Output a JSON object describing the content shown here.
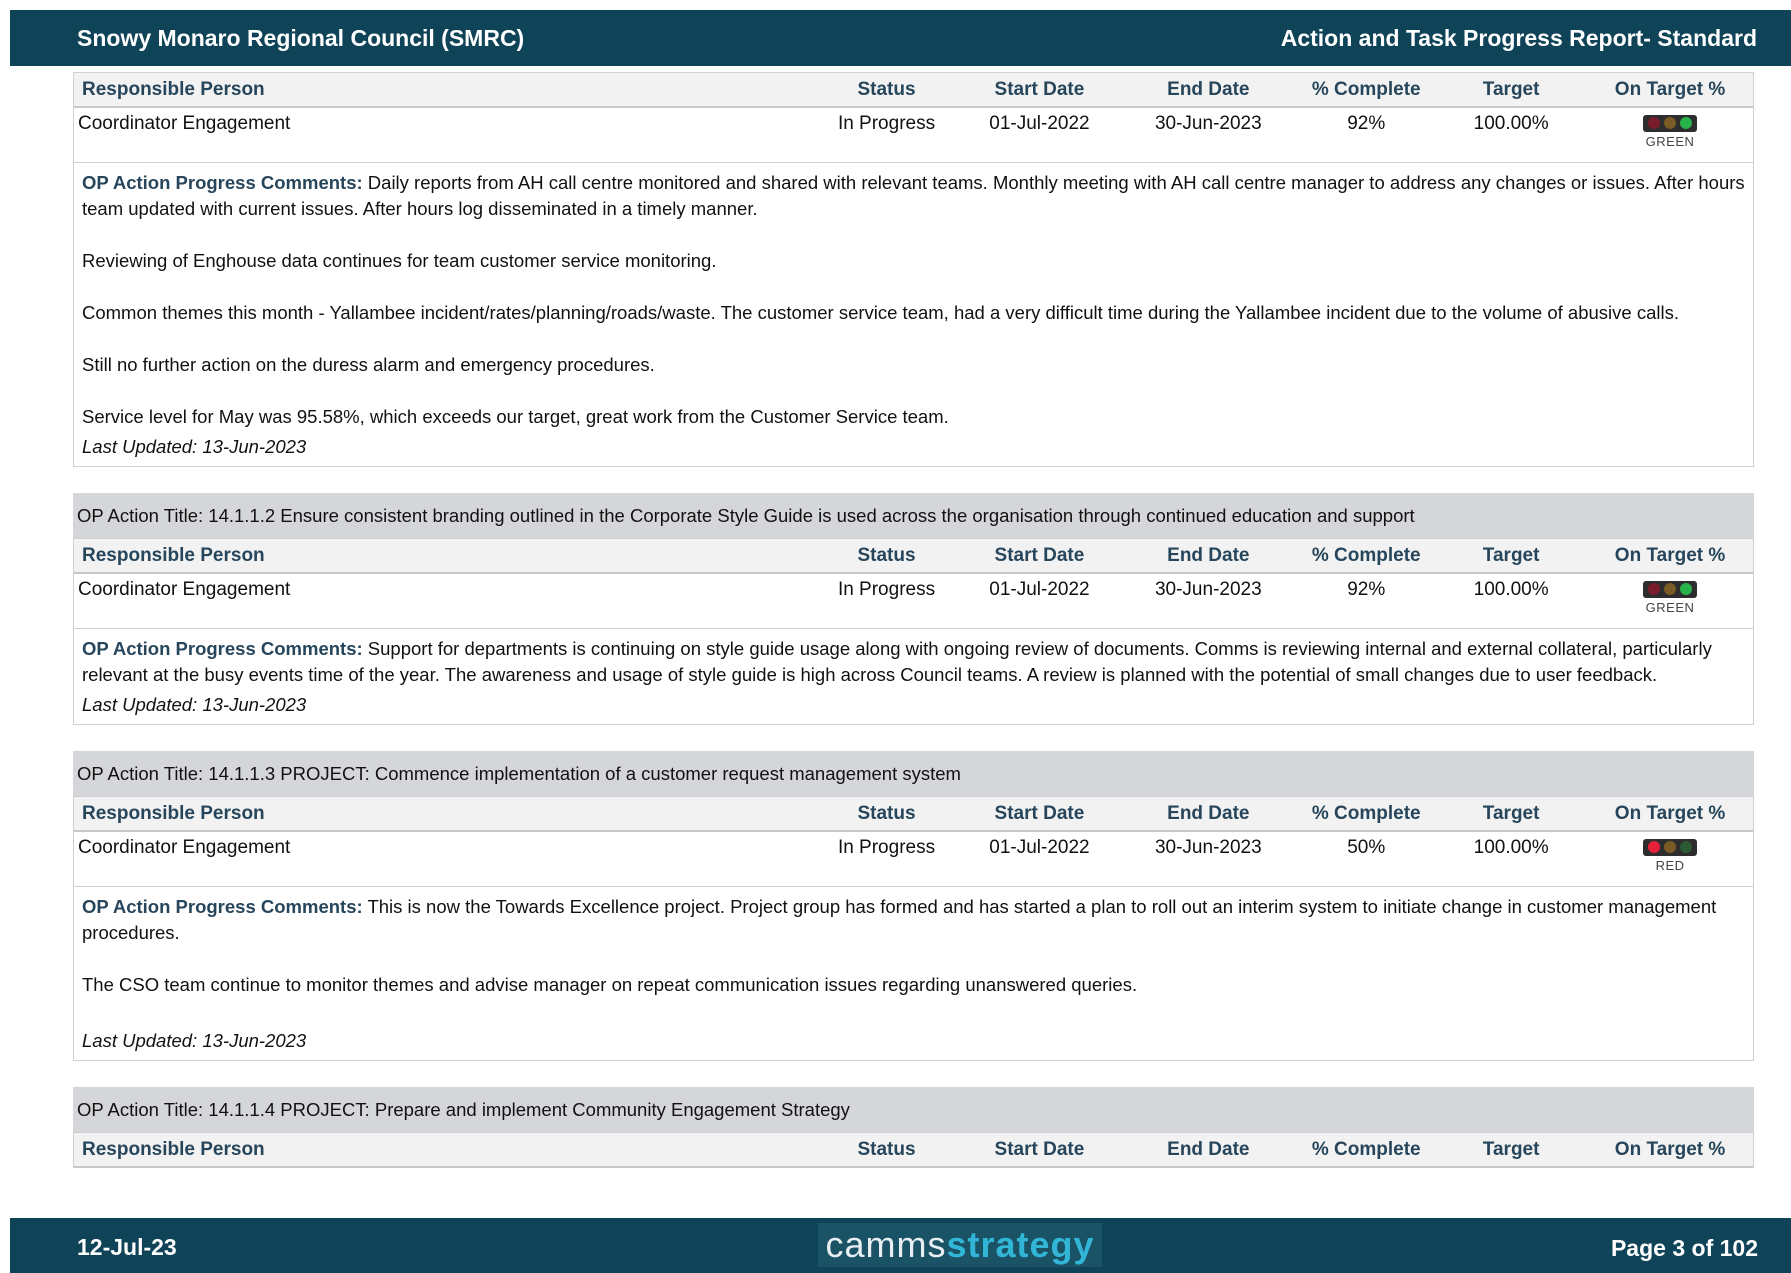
{
  "header": {
    "org": "Snowy Monaro Regional Council (SMRC)",
    "report": "Action and Task Progress Report- Standard"
  },
  "columns": {
    "person": "Responsible Person",
    "status": "Status",
    "start": "Start Date",
    "end": "End Date",
    "pct": "% Complete",
    "target": "Target",
    "ontarget": "On Target %"
  },
  "comment_label": "OP Action Progress Comments:",
  "blocks": [
    {
      "row": {
        "person": "Coordinator Engagement",
        "status": "In Progress",
        "start": "01-Jul-2022",
        "end": "30-Jun-2023",
        "pct": "92%",
        "target": "100.00%",
        "indicator": "GREEN"
      },
      "comment_lead": "Daily reports from AH call centre monitored and shared with relevant teams. Monthly meeting with AH call centre manager to address any changes or issues. After hours team updated with current issues. After hours log disseminated in a timely manner.",
      "comment_p2": "Reviewing of Enghouse data continues for team customer service monitoring.",
      "comment_p3": "Common themes this month - Yallambee incident/rates/planning/roads/waste. The customer service team, had a very difficult time during the Yallambee incident due to the volume of abusive calls.",
      "comment_p4": "Still no further action on the duress alarm and emergency procedures.",
      "comment_p5": "Service level for May was 95.58%, which exceeds our target, great work from the Customer Service team.",
      "updated": "Last Updated: 13-Jun-2023"
    },
    {
      "title": "OP Action Title: 14.1.1.2 Ensure consistent branding outlined in the Corporate Style Guide is used across the organisation through continued education and support",
      "row": {
        "person": "Coordinator Engagement",
        "status": "In Progress",
        "start": "01-Jul-2022",
        "end": "30-Jun-2023",
        "pct": "92%",
        "target": "100.00%",
        "indicator": "GREEN"
      },
      "comment_lead": "Support for departments is continuing on style guide usage along with ongoing review of documents. Comms is reviewing internal and external collateral, particularly relevant at the busy events time of the year. The awareness and usage of style guide is high across Council teams. A review is planned with the potential of small changes due to user feedback.",
      "updated": "Last Updated: 13-Jun-2023"
    },
    {
      "title": "OP Action Title: 14.1.1.3 PROJECT: Commence implementation of a customer request management system",
      "row": {
        "person": "Coordinator Engagement",
        "status": "In Progress",
        "start": "01-Jul-2022",
        "end": "30-Jun-2023",
        "pct": "50%",
        "target": "100.00%",
        "indicator": "RED"
      },
      "comment_lead": "This is now the Towards Excellence project. Project group has formed and has started a plan to roll out an interim system to initiate change in customer management procedures.",
      "comment_p2": "The CSO team continue to monitor themes and advise manager on repeat communication issues regarding unanswered queries.",
      "updated": "Last Updated: 13-Jun-2023"
    },
    {
      "title": "OP Action Title: 14.1.1.4 PROJECT: Prepare and implement Community Engagement Strategy"
    }
  ],
  "footer": {
    "date": "12-Jul-23",
    "logo_a": "camms",
    "logo_b": "strategy",
    "page": "Page 3 of 102"
  }
}
